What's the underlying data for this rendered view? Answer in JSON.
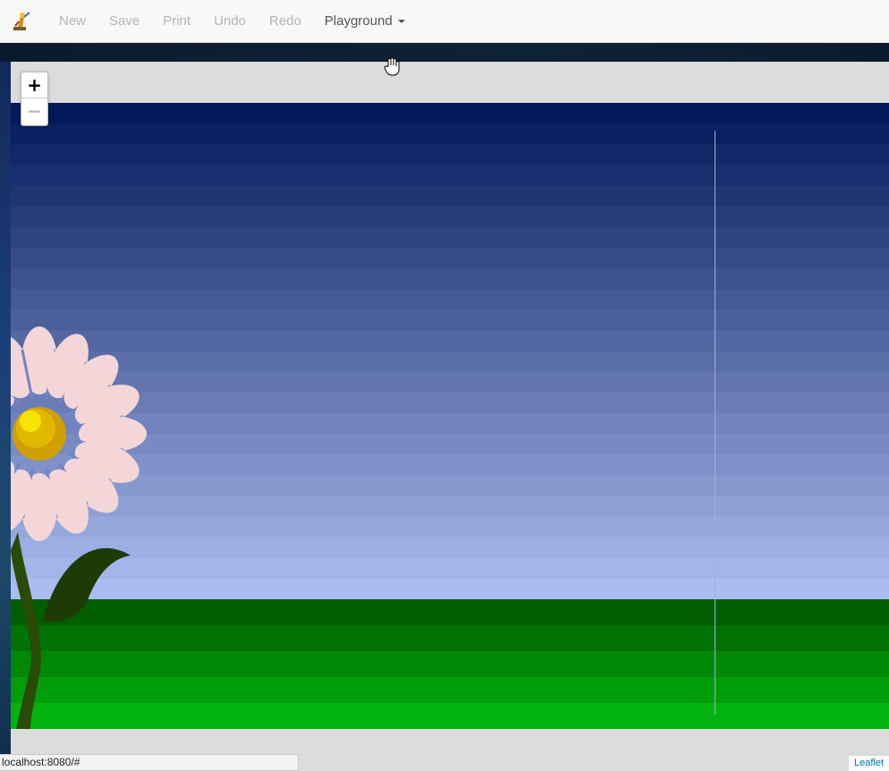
{
  "navbar": {
    "items": [
      {
        "label": "New",
        "enabled": false
      },
      {
        "label": "Save",
        "enabled": false
      },
      {
        "label": "Print",
        "enabled": false
      },
      {
        "label": "Undo",
        "enabled": false
      },
      {
        "label": "Redo",
        "enabled": false
      }
    ],
    "dropdown_label": "Playground",
    "logo_icon": "artist-icon"
  },
  "map": {
    "zoom_in_label": "+",
    "zoom_out_label": "−",
    "attribution": "Leaflet"
  },
  "statusbar": {
    "url": "localhost:8080/#"
  },
  "colors": {
    "sky_top": "#02195a",
    "sky_bottom": "#abbcf0",
    "grass_dark": "#005d00",
    "grass_light": "#00b30e",
    "petal": "#f4d6d8",
    "petal_stripe": "#6f86c4",
    "flower_center": "#e3b800",
    "leaf": "#1f3d05"
  }
}
